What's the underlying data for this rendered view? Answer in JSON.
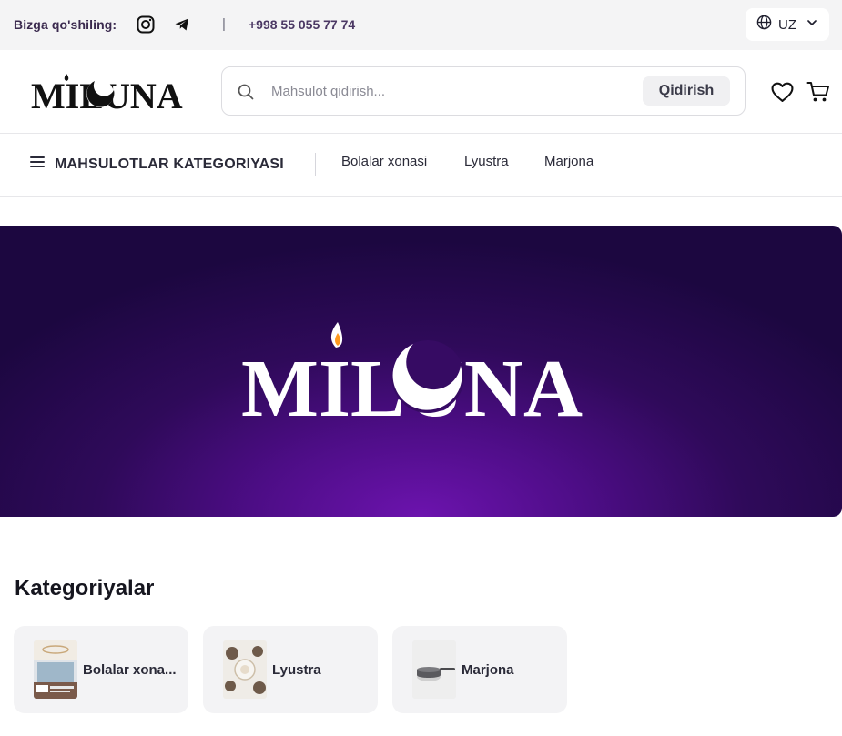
{
  "topbar": {
    "follow_label": "Bizga qo'shiling:",
    "separator": "|",
    "phone": "+998 55 055 77 74",
    "language": "UZ",
    "icons": [
      "instagram-icon",
      "telegram-icon",
      "globe-icon",
      "chevron-down-icon"
    ]
  },
  "header": {
    "logo_text": "MILUNA",
    "search": {
      "placeholder": "Mahsulot qidirish...",
      "value": "",
      "button_label": "Qidirish"
    },
    "icons": [
      "search-icon",
      "heart-icon",
      "cart-icon"
    ]
  },
  "nav": {
    "category_label": "MAHSULOTLAR KATEGORIYASI",
    "links": [
      "Bolalar xonasi",
      "Lyustra",
      "Marjona"
    ]
  },
  "hero": {
    "logo_text": "MILUNA"
  },
  "categories": {
    "title": "Kategoriyalar",
    "items": [
      {
        "name": "Bolalar xona..."
      },
      {
        "name": "Lyustra"
      },
      {
        "name": "Marjona"
      }
    ]
  },
  "colors": {
    "brand_purple": "#4d0d86",
    "hero_dark": "#1c0740",
    "hero_glow": "#6c13ae",
    "topbar_bg": "#f4f4f5",
    "card_bg": "#f3f3f5",
    "flame": "#ff9a1f"
  }
}
